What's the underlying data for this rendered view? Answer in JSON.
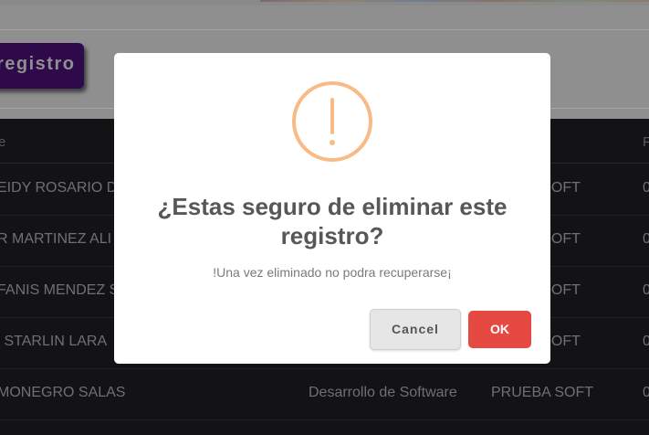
{
  "background": {
    "register_button_label": "registro",
    "table": {
      "headers": [
        "e",
        "F"
      ],
      "rows": [
        {
          "name": "EIDY ROSARIO D",
          "dept": "",
          "company": "A SOFT",
          "extra": "0"
        },
        {
          "name": "R MARTINEZ ALI",
          "dept": "",
          "company": "A SOFT",
          "extra": "0"
        },
        {
          "name": "FANIS MENDEZ S",
          "dept": "",
          "company": "A SOFT",
          "extra": "0"
        },
        {
          "name": "' STARLIN LARA",
          "dept": "",
          "company": "A SOFT",
          "extra": "0"
        },
        {
          "name": "MONEGRO SALAS",
          "dept": "Desarrollo de Software",
          "company": "PRUEBA SOFT",
          "extra": "0"
        }
      ]
    }
  },
  "modal": {
    "icon": "warning-exclamation-icon",
    "title": "¿Estas seguro de eliminar este registro?",
    "text": "!Una vez eliminado no podra recuperarse¡",
    "cancel_label": "Cancel",
    "ok_label": "OK",
    "colors": {
      "icon": "#f8bb86",
      "ok": "#e64942",
      "cancel": "#e6e6e6"
    }
  }
}
